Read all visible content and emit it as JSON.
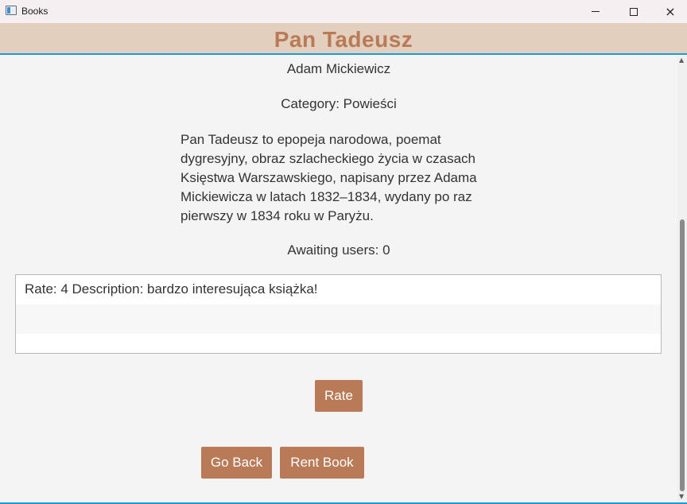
{
  "window": {
    "title": "Books",
    "app_icon": "window-app-icon",
    "controls": {
      "minimize": "minimize-icon",
      "maximize": "maximize-icon",
      "close": "×"
    }
  },
  "book": {
    "title": "Pan Tadeusz",
    "author": "Adam Mickiewicz",
    "category": "Category: Powieści",
    "description": "Pan Tadeusz to epopeja narodowa, poemat dygresyjny, obraz szlacheckiego życia w czasach Księstwa Warszawskiego, napisany przez Adama Mickiewicza w latach 1832–1834, wydany po raz pierwszy w 1834 roku w Paryżu.",
    "awaiting": "Awaiting users: 0"
  },
  "ratings": [
    "Rate: 4 Description: bardzo interesująca książka!",
    "",
    ""
  ],
  "buttons": {
    "rate": "Rate",
    "go_back": "Go Back",
    "rent_book": "Rent Book"
  },
  "colors": {
    "accent": "#b97a57",
    "header_bg": "#e2cfbd",
    "border_blue": "#1e9bd7"
  }
}
